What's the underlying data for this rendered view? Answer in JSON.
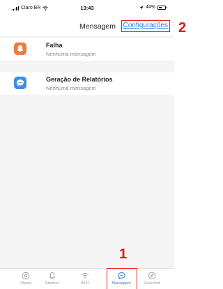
{
  "status_bar": {
    "carrier": "Claro BR",
    "time": "13:43",
    "battery_text": "44%",
    "battery_level": 0.44
  },
  "header": {
    "title": "Mensagem",
    "config_link": "Configurações"
  },
  "items": [
    {
      "name": "Falha",
      "desc": "Nenhuma mensagem",
      "icon": "bell-icon",
      "color": "#f07a3c"
    },
    {
      "name": "Geração de Relatórios",
      "desc": "Nenhuma mensagem",
      "icon": "chat-bubble-icon",
      "color": "#3d8ee6"
    }
  ],
  "tabs": [
    {
      "label": "Planta",
      "icon": "plant-icon"
    },
    {
      "label": "Alarmes",
      "icon": "bell-icon"
    },
    {
      "label": "Wi-Fi",
      "icon": "wifi-icon"
    },
    {
      "label": "Mensagem",
      "icon": "message-icon",
      "active": true
    },
    {
      "label": "Descobrir",
      "icon": "compass-icon"
    }
  ],
  "annotations": {
    "one": "1",
    "two": "2"
  },
  "colors": {
    "accent": "#2a7fd8",
    "highlight": "#e8201a"
  }
}
